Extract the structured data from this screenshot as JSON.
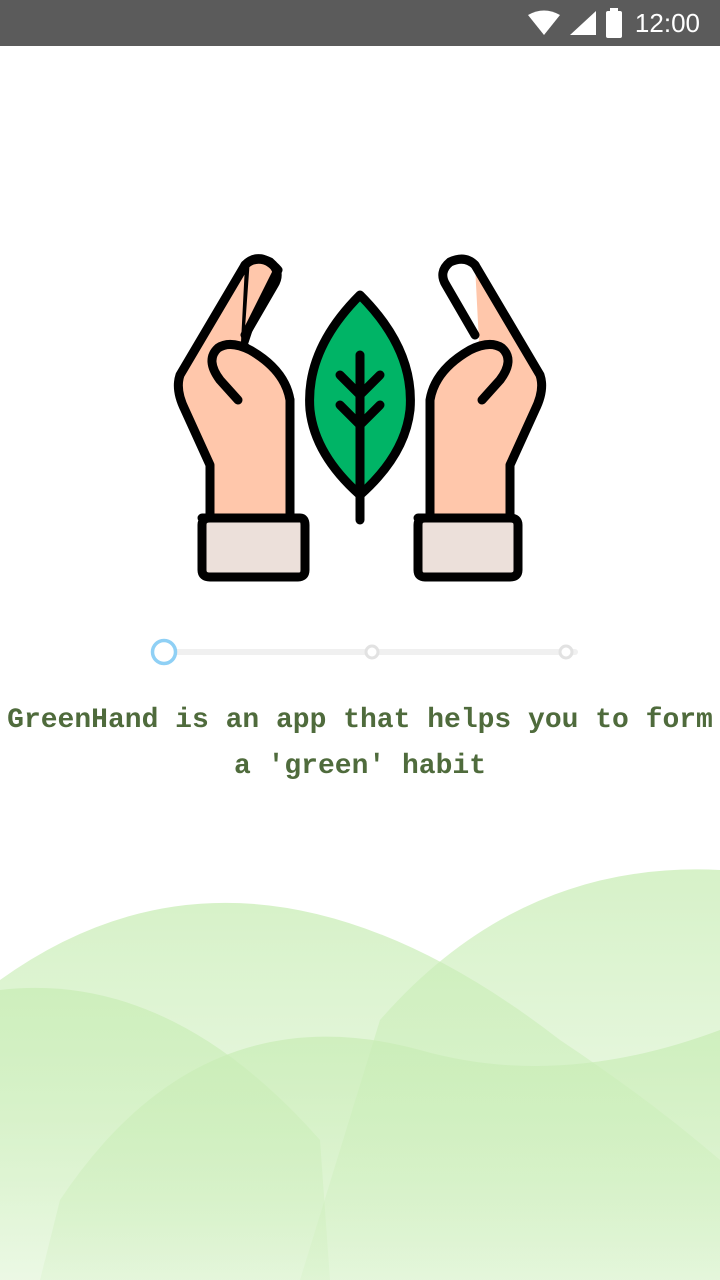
{
  "status_bar": {
    "time": "12:00",
    "icons": [
      "wifi-icon",
      "cellular-signal-icon",
      "battery-icon"
    ]
  },
  "onboarding": {
    "illustration": "hands-holding-leaf-icon",
    "steps_total": 3,
    "current_step": 1,
    "tagline": "GreenHand is an app that helps you to form a 'green' habit"
  },
  "colors": {
    "status_bar": "#5b5b5b",
    "accent_text": "#4f6b3c",
    "leaf_green": "#00b466",
    "skin": "#ffc7ab",
    "active_step": "#8fd0f5",
    "hills": "#c9edb6"
  }
}
